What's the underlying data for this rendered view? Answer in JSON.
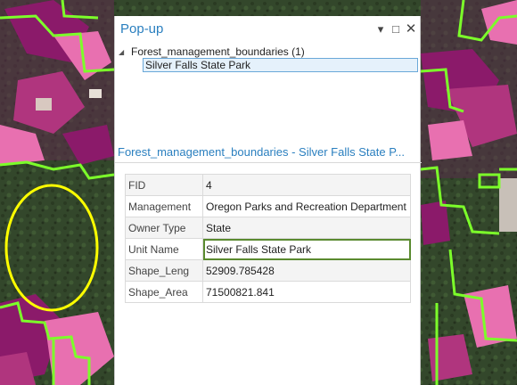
{
  "popup": {
    "title": "Pop-up",
    "pin_icon": "▾",
    "maximize_icon": "□",
    "close_icon": "✕",
    "layer_label": "Forest_management_boundaries (1)",
    "expand_icon": "◢",
    "selected_feature": "Silver Falls State Park",
    "detail_title": "Forest_management_boundaries - Silver Falls State P...",
    "attributes": [
      {
        "field": "FID",
        "value": "4"
      },
      {
        "field": "Management",
        "value": "Oregon Parks and Recreation Department"
      },
      {
        "field": "Owner Type",
        "value": "State"
      },
      {
        "field": "Unit Name",
        "value": "Silver Falls State Park"
      },
      {
        "field": "Shape_Leng",
        "value": "52909.785428"
      },
      {
        "field": "Shape_Area",
        "value": "71500821.841"
      }
    ]
  },
  "colors": {
    "accent": "#2a7fbf",
    "boundary": "#7cff2a",
    "highlight_ellipse": "#ffff00",
    "magenta": "#8b1a6a",
    "pink": "#e870b0"
  }
}
